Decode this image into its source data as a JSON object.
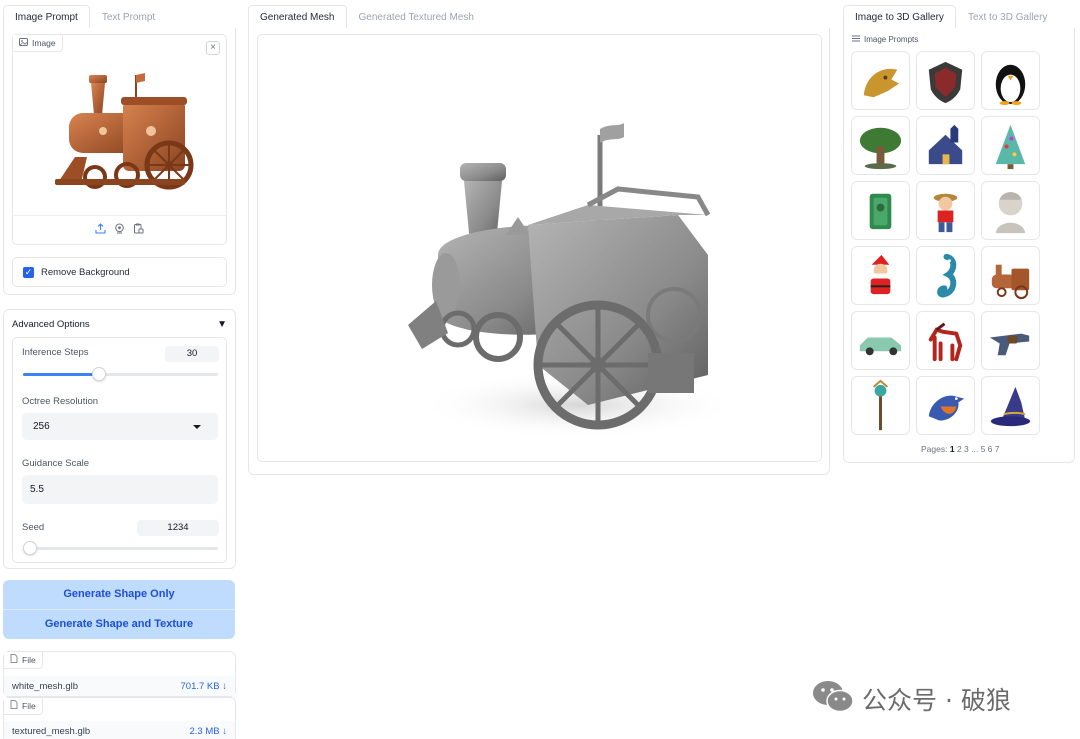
{
  "left": {
    "tabs": [
      "Image Prompt",
      "Text Prompt"
    ],
    "active_tab": 0,
    "image_block": {
      "label": "Image",
      "close": "×"
    },
    "remove_background": {
      "label": "Remove Background",
      "checked": true
    },
    "advanced": {
      "title": "Advanced Options",
      "toggle_glyph": "▼",
      "inference_steps": {
        "label": "Inference Steps",
        "value": "30",
        "slider_fraction": 0.39
      },
      "octree_resolution": {
        "label": "Octree Resolution",
        "value": "256"
      },
      "guidance_scale": {
        "label": "Guidance Scale",
        "value": "5.5"
      },
      "seed": {
        "label": "Seed",
        "value": "1234",
        "slider_fraction": 0.0
      }
    },
    "buttons": {
      "shape_only": "Generate Shape Only",
      "shape_texture": "Generate Shape and Texture"
    },
    "files": [
      {
        "chip": "File",
        "name": "white_mesh.glb",
        "size": "701.7 KB ↓"
      },
      {
        "chip": "File",
        "name": "textured_mesh.glb",
        "size": "2.3 MB ↓"
      }
    ]
  },
  "center": {
    "tabs": [
      "Generated Mesh",
      "Generated Textured Mesh"
    ],
    "active_tab": 0
  },
  "right": {
    "tabs": [
      "Image to 3D Gallery",
      "Text to 3D Gallery"
    ],
    "active_tab": 0,
    "section_label": "Image Prompts",
    "gallery": [
      "dragon-head-icon",
      "shield-icon",
      "penguin-icon",
      "tree-icon",
      "house-icon",
      "christmas-tree-icon",
      "jade-pendant-icon",
      "pirate-figure-icon",
      "bust-icon",
      "santa-icon",
      "seahorse-icon",
      "train-icon",
      "car-icon",
      "horse-icon",
      "revolver-icon",
      "staff-icon",
      "bird-icon",
      "wizard-hat-icon"
    ],
    "pages": {
      "prefix": "Pages:",
      "current": "1",
      "rest": "2 3 ... 5 6 7"
    }
  },
  "watermark": {
    "text": "公众号 · 破狼"
  },
  "colors": {
    "accent": "#2563eb",
    "button_bg": "#bfdbfe",
    "button_text": "#1d4ed8",
    "train_copper": "#b5653a",
    "mesh_grey": "#8a8a8a"
  }
}
